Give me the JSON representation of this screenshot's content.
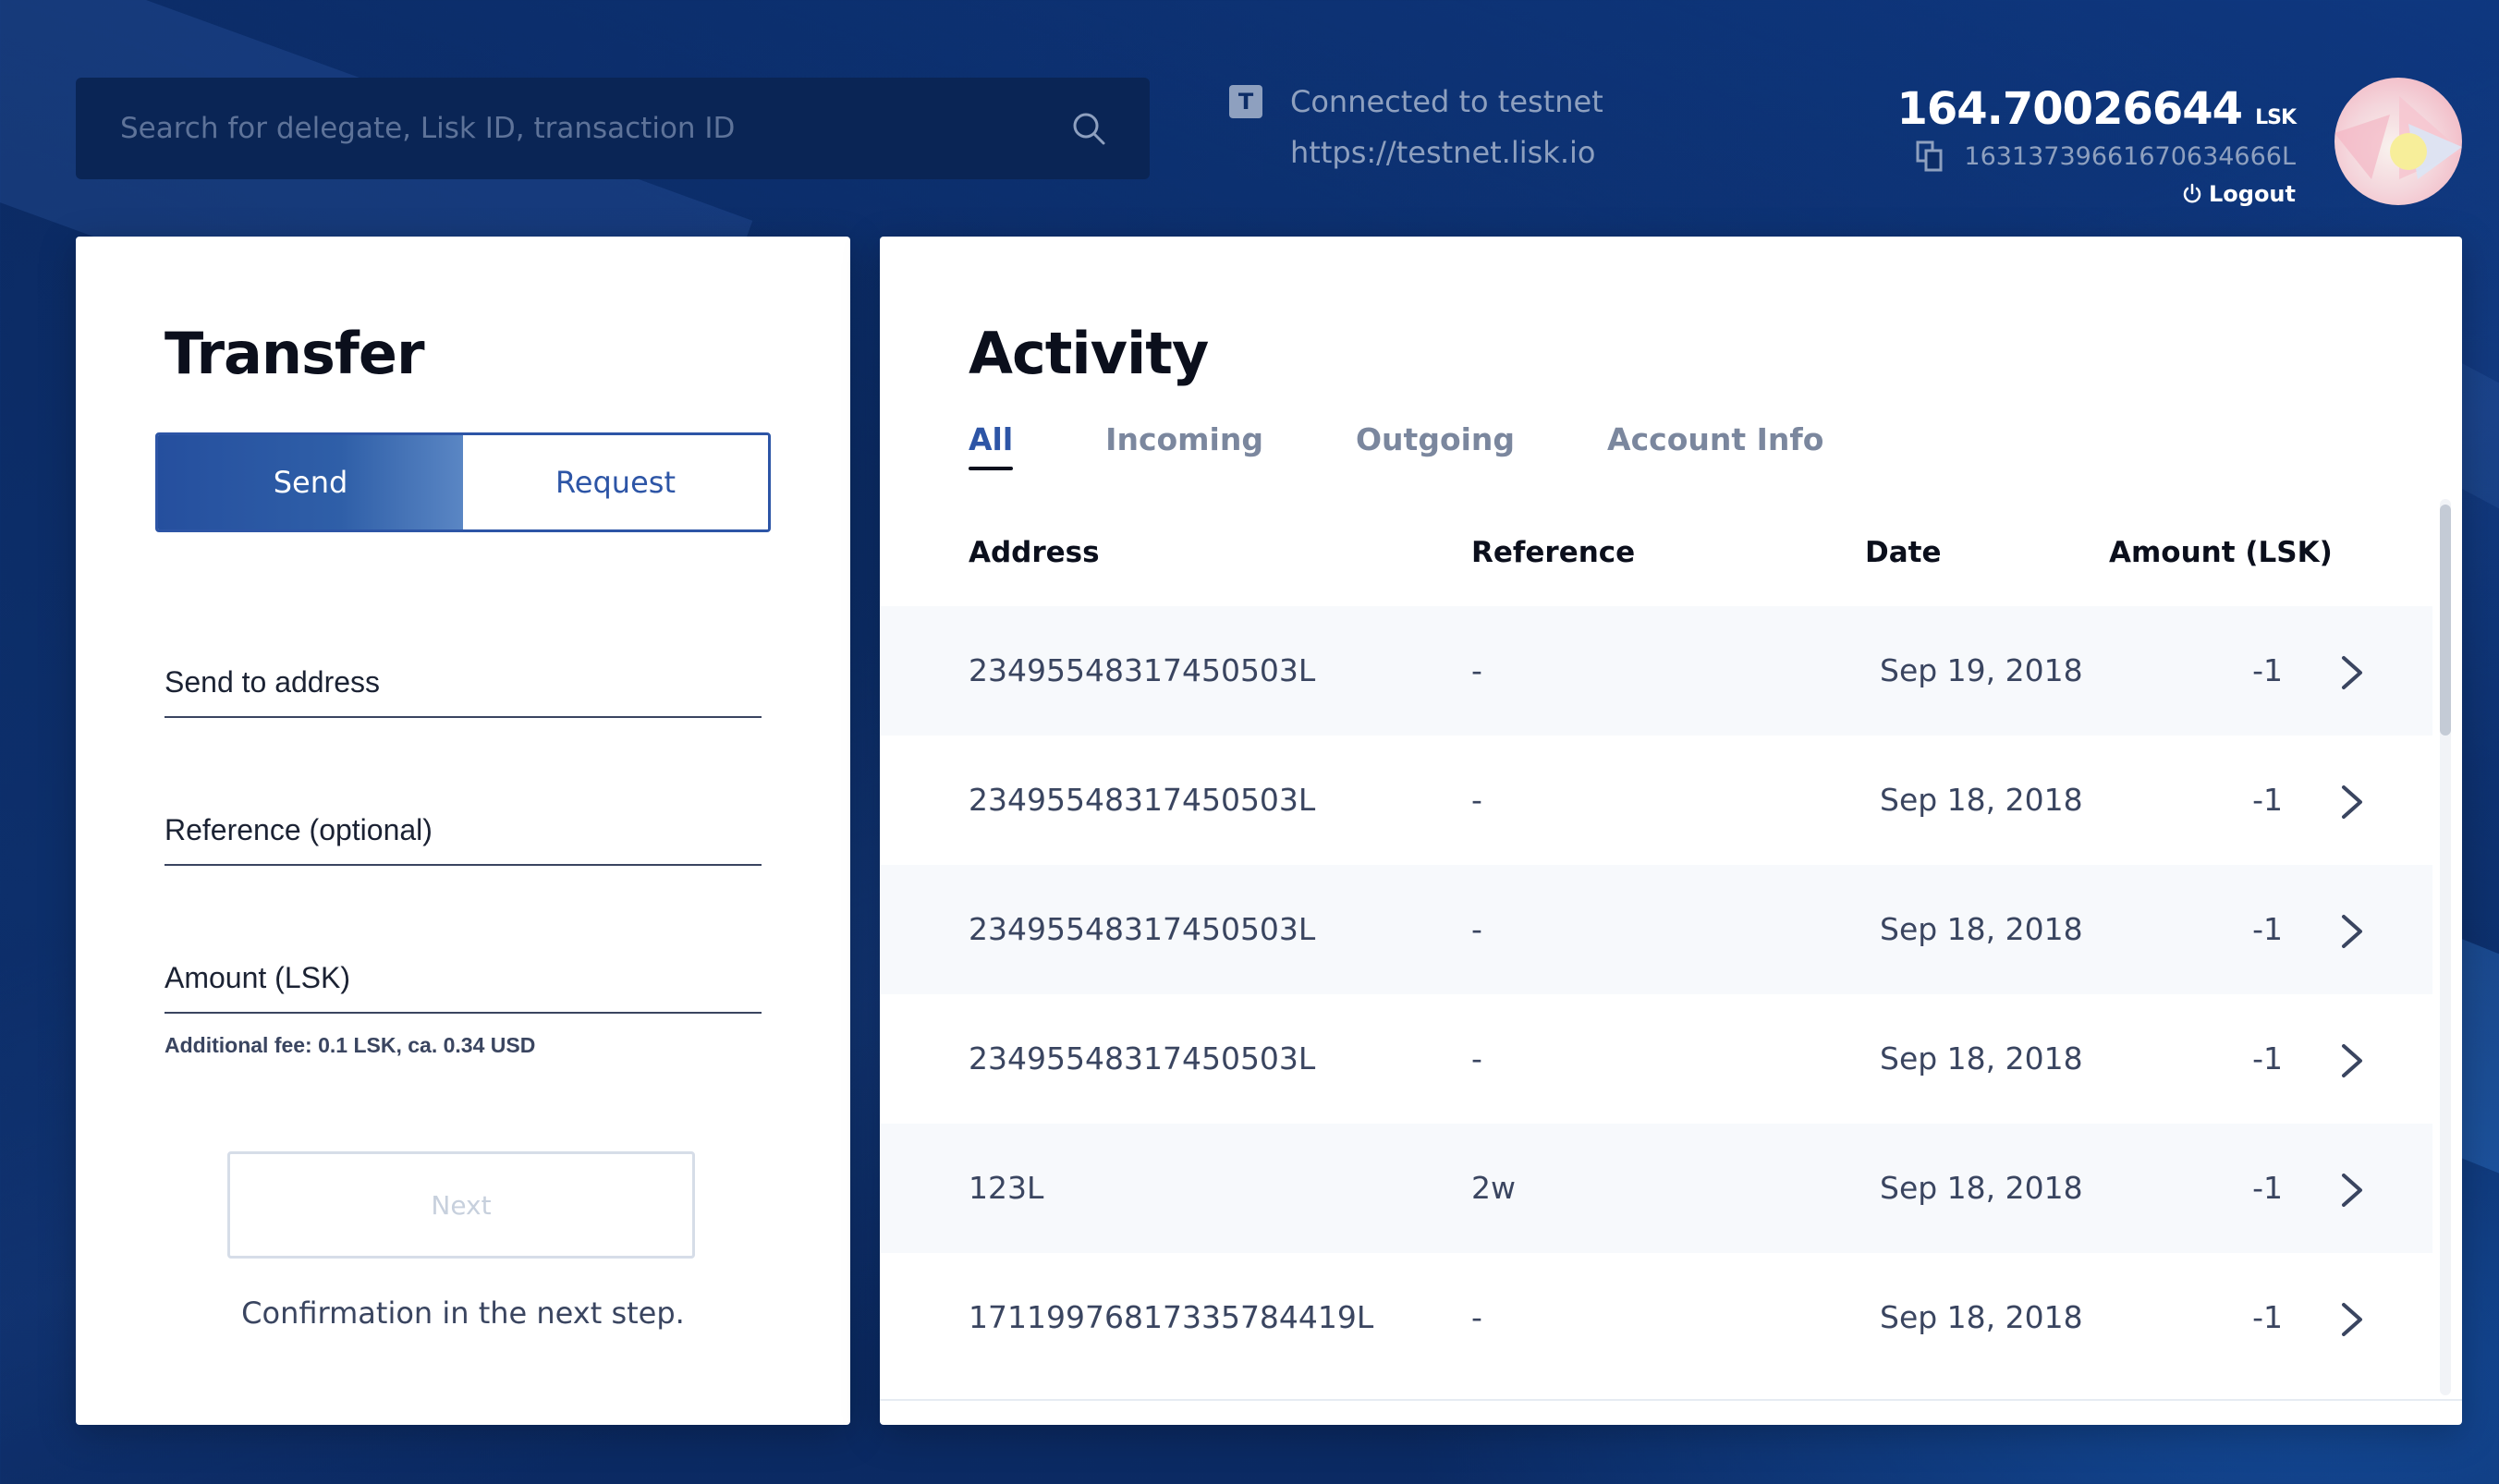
{
  "search": {
    "placeholder": "Search for delegate, Lisk ID, transaction ID"
  },
  "network": {
    "badge": "T",
    "status": "Connected to testnet",
    "url": "https://testnet.lisk.io"
  },
  "account": {
    "balance": "164.70026644",
    "unit": "LSK",
    "address": "16313739661670634666L",
    "logout_label": "Logout"
  },
  "transfer": {
    "title": "Transfer",
    "send_label": "Send",
    "request_label": "Request",
    "address_placeholder": "Send to address",
    "reference_placeholder": "Reference (optional)",
    "amount_placeholder": "Amount (LSK)",
    "fee_note": "Additional fee: 0.1 LSK, ca. 0.34 USD",
    "next_label": "Next",
    "confirm_note": "Confirmation in the next step."
  },
  "activity": {
    "title": "Activity",
    "tabs": [
      "All",
      "Incoming",
      "Outgoing",
      "Account Info"
    ],
    "columns": {
      "address": "Address",
      "reference": "Reference",
      "date": "Date",
      "amount": "Amount (LSK)"
    },
    "rows": [
      {
        "address": "23495548317450503L",
        "reference": "-",
        "date": "Sep 19, 2018",
        "amount": "-1"
      },
      {
        "address": "23495548317450503L",
        "reference": "-",
        "date": "Sep 18, 2018",
        "amount": "-1"
      },
      {
        "address": "23495548317450503L",
        "reference": "-",
        "date": "Sep 18, 2018",
        "amount": "-1"
      },
      {
        "address": "23495548317450503L",
        "reference": "-",
        "date": "Sep 18, 2018",
        "amount": "-1"
      },
      {
        "address": "123L",
        "reference": "2w",
        "date": "Sep 18, 2018",
        "amount": "-1"
      },
      {
        "address": "17119976817335784419L",
        "reference": "-",
        "date": "Sep 18, 2018",
        "amount": "-1"
      }
    ]
  },
  "colors": {
    "background": "#0c2c66",
    "accent": "#2d55a6",
    "card": "#ffffff"
  }
}
